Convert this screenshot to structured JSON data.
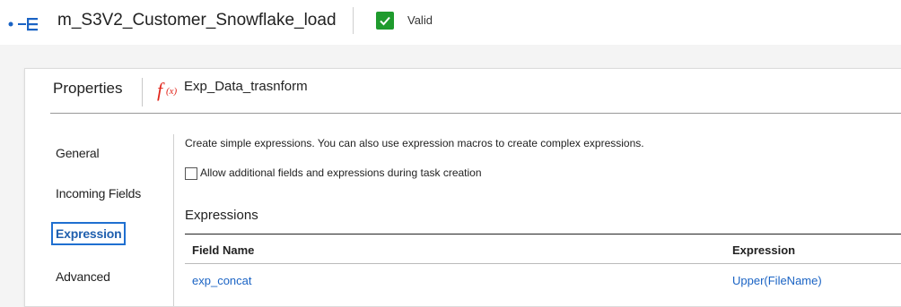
{
  "header": {
    "mapping_name": "m_S3V2_Customer_Snowflake_load",
    "status_label": "Valid",
    "mapping_icon": "mapping-flow-icon",
    "status_icon": "checkmark-icon"
  },
  "panel": {
    "title": "Properties",
    "transformation_icon": "expression-fx-icon",
    "transformation_name": "Exp_Data_trasnform"
  },
  "nav": {
    "items": [
      {
        "label": "General",
        "active": false
      },
      {
        "label": "Incoming Fields",
        "active": false
      },
      {
        "label": "Expression",
        "active": true
      },
      {
        "label": "Advanced",
        "active": false
      }
    ]
  },
  "content": {
    "description": "Create simple expressions. You can also use expression macros to create complex expressions.",
    "checkbox_label": "Allow additional fields and expressions during task creation",
    "checkbox_checked": false,
    "section_title": "Expressions",
    "table": {
      "columns": [
        "Field Name",
        "Expression"
      ],
      "rows": [
        {
          "field_name": "exp_concat",
          "expression": "Upper(FileName)"
        }
      ]
    }
  },
  "colors": {
    "accent": "#1f6fd0",
    "link": "#1a63c4",
    "valid_green": "#1f9b2d",
    "fx_red": "#e1251b"
  }
}
